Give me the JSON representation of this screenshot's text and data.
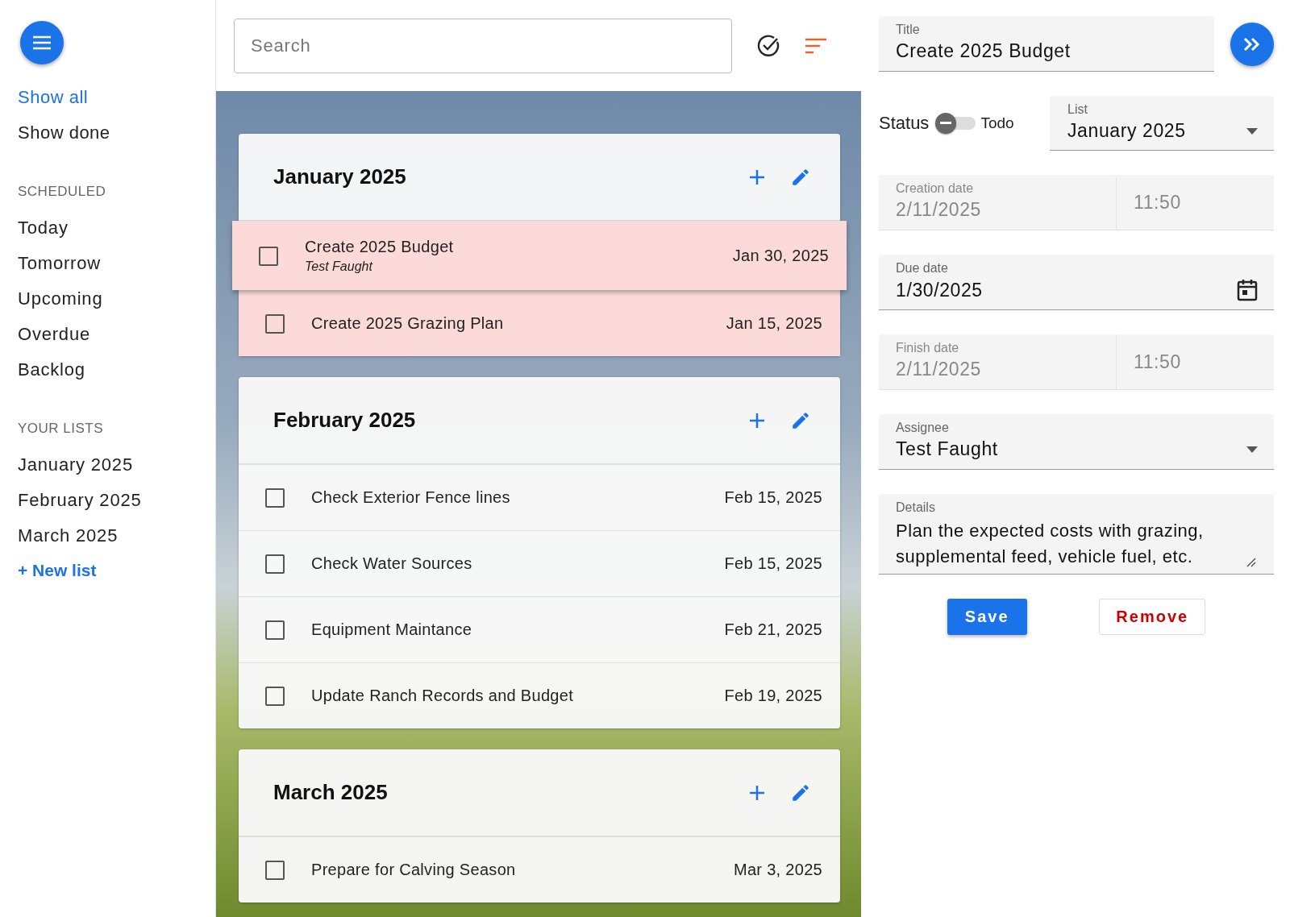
{
  "sidebar": {
    "nav": [
      {
        "label": "Show all",
        "selected": true
      },
      {
        "label": "Show done",
        "selected": false
      }
    ],
    "sections": [
      {
        "heading": "SCHEDULED",
        "items": [
          {
            "label": "Today"
          },
          {
            "label": "Tomorrow"
          },
          {
            "label": "Upcoming"
          },
          {
            "label": "Overdue"
          },
          {
            "label": "Backlog"
          }
        ]
      },
      {
        "heading": "YOUR LISTS",
        "items": [
          {
            "label": "January 2025"
          },
          {
            "label": "February 2025"
          },
          {
            "label": "March 2025"
          }
        ]
      }
    ],
    "new_list": "+ New list"
  },
  "toolbar": {
    "search": {
      "placeholder": "Search"
    }
  },
  "lists": [
    {
      "title": "January 2025",
      "tasks": [
        {
          "title": "Create 2025 Budget",
          "assignee": "Test Faught",
          "date": "Jan 30, 2025",
          "checked": false,
          "overdue": true,
          "selected": true
        },
        {
          "title": "Create 2025 Grazing Plan",
          "date": "Jan 15, 2025",
          "checked": false,
          "overdue": true,
          "selected": false
        }
      ]
    },
    {
      "title": "February 2025",
      "tasks": [
        {
          "title": "Check Exterior Fence lines",
          "date": "Feb 15, 2025",
          "checked": false,
          "overdue": false,
          "selected": false
        },
        {
          "title": "Check Water Sources",
          "date": "Feb 15, 2025",
          "checked": false,
          "overdue": false,
          "selected": false
        },
        {
          "title": "Equipment Maintance",
          "date": "Feb 21, 2025",
          "checked": false,
          "overdue": false,
          "selected": false
        },
        {
          "title": "Update Ranch Records and Budget",
          "date": "Feb 19, 2025",
          "checked": false,
          "overdue": false,
          "selected": false
        }
      ]
    },
    {
      "title": "March 2025",
      "tasks": [
        {
          "title": "Prepare for Calving Season",
          "date": "Mar 3, 2025",
          "checked": false,
          "overdue": false,
          "selected": false
        }
      ]
    }
  ],
  "detail": {
    "title": {
      "label": "Title",
      "value": "Create 2025 Budget"
    },
    "status": {
      "label": "Status",
      "on": false,
      "state_label": "Todo"
    },
    "list": {
      "label": "List",
      "value": "January 2025"
    },
    "creation": {
      "label": "Creation date",
      "value": "2/11/2025",
      "time": "11:50",
      "disabled": true
    },
    "due": {
      "label": "Due date",
      "value": "1/30/2025",
      "disabled": false
    },
    "finish": {
      "label": "Finish date",
      "value": "2/11/2025",
      "time": "11:50",
      "disabled": true
    },
    "assignee": {
      "label": "Assignee",
      "value": "Test Faught"
    },
    "details": {
      "label": "Details",
      "value": "Plan the expected costs with grazing, supplemental feed, vehicle fuel, etc."
    },
    "buttons": {
      "save": "Save",
      "remove": "Remove"
    }
  }
}
